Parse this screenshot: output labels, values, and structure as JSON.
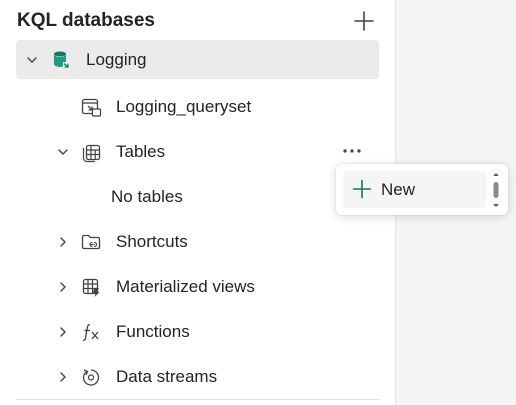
{
  "header": {
    "title": "KQL databases",
    "add_icon": "plus-icon"
  },
  "tree": {
    "database": {
      "label": "Logging",
      "icon": "database-icon",
      "expanded": true
    },
    "queryset": {
      "label": "Logging_queryset",
      "icon": "queryset-icon"
    },
    "tables": {
      "label": "Tables",
      "icon": "table-icon",
      "expanded": true,
      "more_icon": "more-horizontal-icon"
    },
    "no_tables": {
      "label": "No tables"
    },
    "shortcuts": {
      "label": "Shortcuts",
      "icon": "folder-link-icon",
      "expanded": false
    },
    "materialized_views": {
      "label": "Materialized views",
      "icon": "materialized-view-icon",
      "expanded": false
    },
    "functions": {
      "label": "Functions",
      "icon": "function-icon",
      "expanded": false
    },
    "data_streams": {
      "label": "Data streams",
      "icon": "data-stream-icon",
      "expanded": false
    }
  },
  "context_menu": {
    "items": [
      {
        "label": "New",
        "icon": "plus-icon"
      }
    ]
  },
  "colors": {
    "accent_green": "#117865",
    "selected_row": "#ebebeb",
    "text": "#242424"
  }
}
